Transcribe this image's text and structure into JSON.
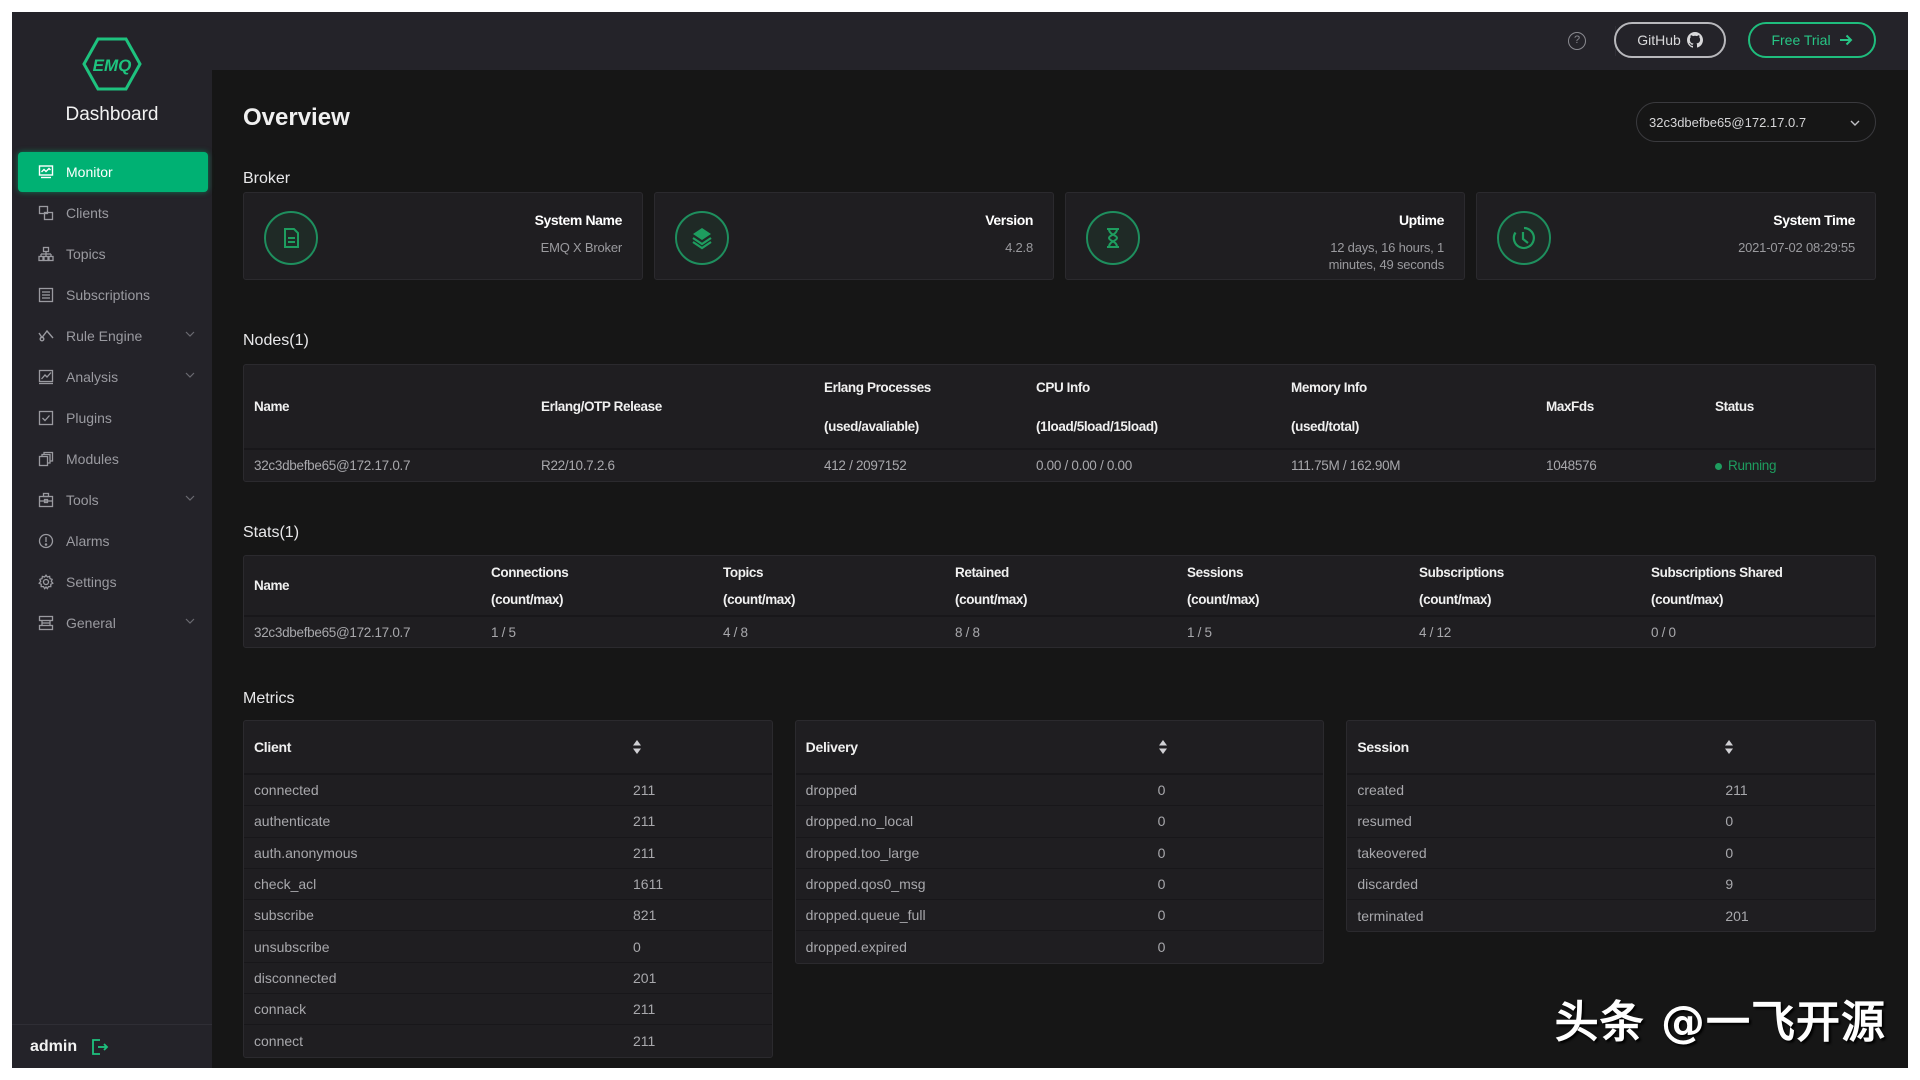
{
  "app": {
    "brand": "Dashboard",
    "logo_text": "EMQ",
    "accent_color": "#00b173"
  },
  "sidebar": {
    "items": [
      {
        "label": "Monitor",
        "icon": "monitor-icon",
        "active": true,
        "expandable": false
      },
      {
        "label": "Clients",
        "icon": "clients-icon",
        "active": false,
        "expandable": false
      },
      {
        "label": "Topics",
        "icon": "topics-icon",
        "active": false,
        "expandable": false
      },
      {
        "label": "Subscriptions",
        "icon": "subscriptions-icon",
        "active": false,
        "expandable": false
      },
      {
        "label": "Rule Engine",
        "icon": "rule-engine-icon",
        "active": false,
        "expandable": true
      },
      {
        "label": "Analysis",
        "icon": "analysis-icon",
        "active": false,
        "expandable": true
      },
      {
        "label": "Plugins",
        "icon": "plugins-icon",
        "active": false,
        "expandable": false
      },
      {
        "label": "Modules",
        "icon": "modules-icon",
        "active": false,
        "expandable": false
      },
      {
        "label": "Tools",
        "icon": "tools-icon",
        "active": false,
        "expandable": true
      },
      {
        "label": "Alarms",
        "icon": "alarms-icon",
        "active": false,
        "expandable": false
      },
      {
        "label": "Settings",
        "icon": "settings-icon",
        "active": false,
        "expandable": false
      },
      {
        "label": "General",
        "icon": "general-icon",
        "active": false,
        "expandable": true
      }
    ],
    "user": "admin"
  },
  "header": {
    "help_icon": "?",
    "github_label": "GitHub",
    "trial_label": "Free Trial"
  },
  "main": {
    "title": "Overview",
    "node_selector": "32c3dbefbe65@172.17.0.7",
    "broker": {
      "title": "Broker",
      "cards": [
        {
          "label": "System Name",
          "value": "EMQ X Broker",
          "icon": "document-icon"
        },
        {
          "label": "Version",
          "value": "4.2.8",
          "icon": "layers-icon"
        },
        {
          "label": "Uptime",
          "value": "12 days, 16 hours, 1 minutes, 49 seconds",
          "value_line1": "12 days, 16 hours, 1",
          "value_line2": "minutes, 49 seconds",
          "icon": "hourglass-icon"
        },
        {
          "label": "System Time",
          "value": "2021-07-02 08:29:55",
          "icon": "clock-icon"
        }
      ]
    },
    "nodes": {
      "title": "Nodes(1)",
      "headers": [
        {
          "l1": "Name",
          "l2": ""
        },
        {
          "l1": "Erlang/OTP Release",
          "l2": ""
        },
        {
          "l1": "Erlang Processes",
          "l2": "(used/avaliable)"
        },
        {
          "l1": "CPU Info",
          "l2": "(1load/5load/15load)"
        },
        {
          "l1": "Memory Info",
          "l2": "(used/total)"
        },
        {
          "l1": "MaxFds",
          "l2": ""
        },
        {
          "l1": "Status",
          "l2": ""
        }
      ],
      "rows": [
        {
          "name": "32c3dbefbe65@172.17.0.7",
          "otp": "R22/10.7.2.6",
          "processes": "412 / 2097152",
          "cpu": "0.00 / 0.00 / 0.00",
          "memory": "111.75M / 162.90M",
          "maxfds": "1048576",
          "status": "Running"
        }
      ]
    },
    "stats": {
      "title": "Stats(1)",
      "headers": [
        {
          "l1": "Name",
          "l2": ""
        },
        {
          "l1": "Connections",
          "l2": "(count/max)"
        },
        {
          "l1": "Topics",
          "l2": "(count/max)"
        },
        {
          "l1": "Retained",
          "l2": "(count/max)"
        },
        {
          "l1": "Sessions",
          "l2": "(count/max)"
        },
        {
          "l1": "Subscriptions",
          "l2": "(count/max)"
        },
        {
          "l1": "Subscriptions Shared",
          "l2": "(count/max)"
        }
      ],
      "rows": [
        {
          "name": "32c3dbefbe65@172.17.0.7",
          "connections": "1 / 5",
          "topics": "4 / 8",
          "retained": "8 / 8",
          "sessions": "1 / 5",
          "subscriptions": "4 / 12",
          "subscriptions_shared": "0 / 0"
        }
      ]
    },
    "metrics": {
      "title": "Metrics",
      "client": {
        "title": "Client",
        "rows": [
          {
            "k": "connected",
            "v": "211"
          },
          {
            "k": "authenticate",
            "v": "211"
          },
          {
            "k": "auth.anonymous",
            "v": "211"
          },
          {
            "k": "check_acl",
            "v": "1611"
          },
          {
            "k": "subscribe",
            "v": "821"
          },
          {
            "k": "unsubscribe",
            "v": "0"
          },
          {
            "k": "disconnected",
            "v": "201"
          },
          {
            "k": "connack",
            "v": "211"
          },
          {
            "k": "connect",
            "v": "211"
          }
        ]
      },
      "delivery": {
        "title": "Delivery",
        "rows": [
          {
            "k": "dropped",
            "v": "0"
          },
          {
            "k": "dropped.no_local",
            "v": "0"
          },
          {
            "k": "dropped.too_large",
            "v": "0"
          },
          {
            "k": "dropped.qos0_msg",
            "v": "0"
          },
          {
            "k": "dropped.queue_full",
            "v": "0"
          },
          {
            "k": "dropped.expired",
            "v": "0"
          }
        ]
      },
      "session": {
        "title": "Session",
        "rows": [
          {
            "k": "created",
            "v": "211"
          },
          {
            "k": "resumed",
            "v": "0"
          },
          {
            "k": "takeovered",
            "v": "0"
          },
          {
            "k": "discarded",
            "v": "9"
          },
          {
            "k": "terminated",
            "v": "201"
          }
        ]
      }
    }
  },
  "watermark": "头条 @一飞开源"
}
